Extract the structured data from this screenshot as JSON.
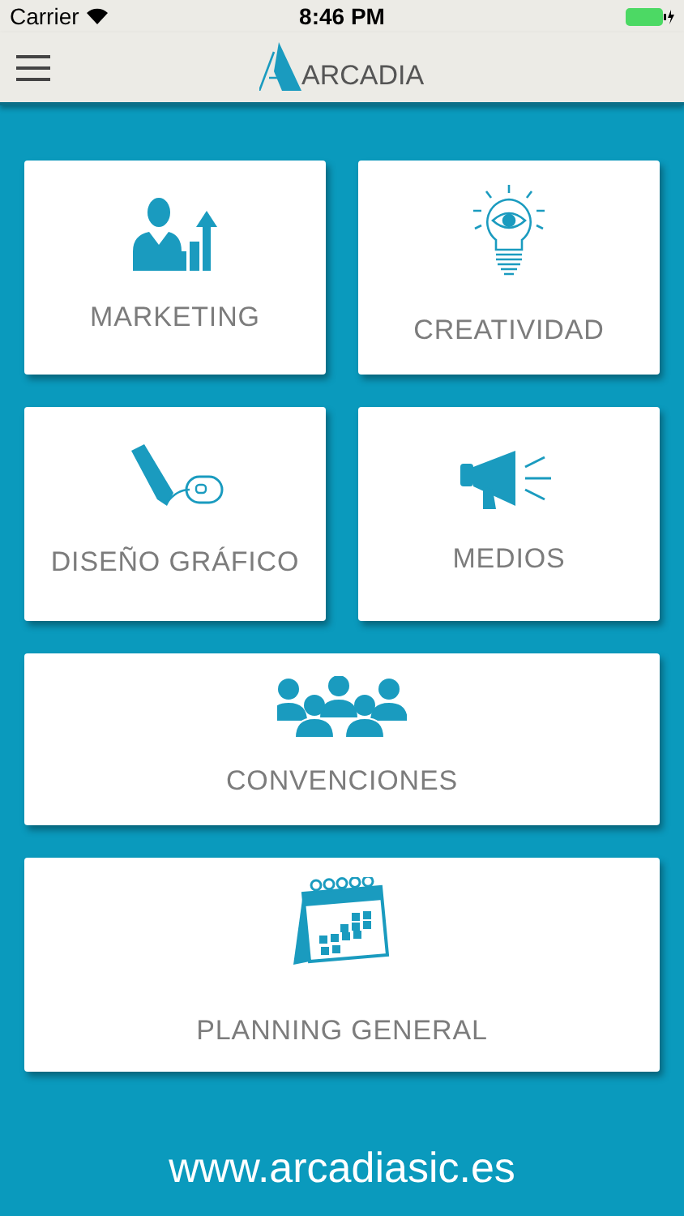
{
  "status_bar": {
    "carrier": "Carrier",
    "time": "8:46 PM"
  },
  "nav": {
    "logo": "ARCADIA"
  },
  "tiles": [
    {
      "label": "MARKETING",
      "kind": "half"
    },
    {
      "label": "CREATIVIDAD",
      "kind": "half"
    },
    {
      "label": "DISEÑO GRÁFICO",
      "kind": "half"
    },
    {
      "label": "MEDIOS",
      "kind": "half"
    },
    {
      "label": "CONVENCIONES",
      "kind": "wide"
    },
    {
      "label": "PLANNING GENERAL",
      "kind": "tall"
    }
  ],
  "footer": "www.arcadiasic.es"
}
